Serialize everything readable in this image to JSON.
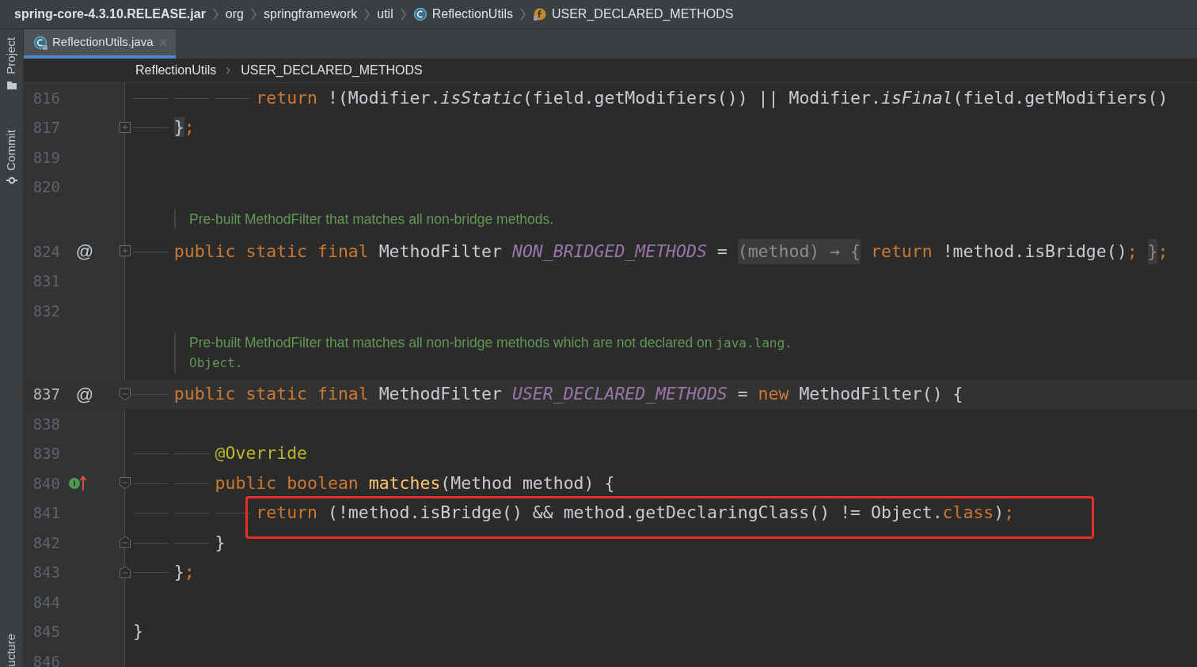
{
  "breadcrumbs": [
    {
      "text": "spring-core-4.3.10.RELEASE.jar",
      "kind": "jar"
    },
    {
      "text": "org",
      "kind": "package"
    },
    {
      "text": "springframework",
      "kind": "package"
    },
    {
      "text": "util",
      "kind": "package"
    },
    {
      "text": "ReflectionUtils",
      "kind": "class"
    },
    {
      "text": "USER_DECLARED_METHODS",
      "kind": "field"
    }
  ],
  "side_tabs": [
    {
      "label": "Project",
      "kind": "folder"
    },
    {
      "label": "Commit",
      "kind": "commit"
    },
    {
      "label": "ucture",
      "kind": "bottom"
    }
  ],
  "tabs": [
    {
      "label": "ReflectionUtils.java",
      "selected": true
    }
  ],
  "editor_breadcrumbs": [
    "ReflectionUtils",
    "USER_DECLARED_METHODS"
  ],
  "lines": [
    {
      "kind": "code",
      "number": "816",
      "current": false,
      "marked": false,
      "tokens": [
        {
          "text": "            return",
          "kind": "kw"
        },
        {
          "text": " !(Modifier.",
          "kind": "plain"
        },
        {
          "text": "isStatic",
          "kind": "italic"
        },
        {
          "text": "(field.getModifiers()) || Modifier.",
          "kind": "plain"
        },
        {
          "text": "isFinal",
          "kind": "italic"
        },
        {
          "text": "(field.getModifiers()",
          "kind": "plain"
        }
      ]
    },
    {
      "kind": "code",
      "number": "817",
      "current": false,
      "marked": false,
      "fold": {
        "kind": "plus"
      },
      "tokens": [
        {
          "text": "    }",
          "kind": "match"
        },
        {
          "text": ";",
          "kind": "kw"
        }
      ]
    },
    {
      "kind": "code",
      "number": "819",
      "current": false,
      "marked": false
    },
    {
      "kind": "code",
      "number": "820",
      "current": false,
      "marked": false
    },
    {
      "kind": "doc",
      "lines": [
        [
          {
            "text": "Pre-built MethodFilter that matches all non-bridge methods.",
            "kind": "prose"
          }
        ]
      ]
    },
    {
      "kind": "code",
      "number": "824",
      "current": false,
      "marked": false,
      "gutter": {
        "kind": "at",
        "text": "@"
      },
      "fold": {
        "kind": "plus"
      },
      "tokens": [
        {
          "text": "    public static final",
          "kind": "kw"
        },
        {
          "text": " MethodFilter ",
          "kind": "plain"
        },
        {
          "text": "NON_BRIDGED_METHODS",
          "kind": "const"
        },
        {
          "text": " = ",
          "kind": "plain"
        },
        {
          "text": "(method) → {",
          "kind": "folded"
        },
        {
          "text": " return",
          "kind": "kw"
        },
        {
          "text": " !method.isBridge()",
          "kind": "plain"
        },
        {
          "text": "; ",
          "kind": "kw"
        },
        {
          "text": "}",
          "kind": "folded"
        },
        {
          "text": ";",
          "kind": "kw"
        }
      ]
    },
    {
      "kind": "code",
      "number": "831",
      "current": false,
      "marked": false
    },
    {
      "kind": "code",
      "number": "832",
      "current": false,
      "marked": false
    },
    {
      "kind": "doc",
      "lines": [
        [
          {
            "text": "Pre-built MethodFilter that matches all non-bridge methods which are not declared on ",
            "kind": "prose"
          },
          {
            "text": "java.lang.",
            "kind": "code"
          }
        ],
        [
          {
            "text": "Object.",
            "kind": "code"
          }
        ]
      ]
    },
    {
      "kind": "code",
      "number": "837",
      "current": true,
      "marked": false,
      "gutter": {
        "kind": "at",
        "text": "@"
      },
      "fold": {
        "kind": "open"
      },
      "tokens": [
        {
          "text": "    public static final",
          "kind": "kw"
        },
        {
          "text": " MethodFilter ",
          "kind": "plain"
        },
        {
          "text": "USER_DECLARED_METHODS",
          "kind": "const"
        },
        {
          "text": " = ",
          "kind": "plain"
        },
        {
          "text": "new",
          "kind": "kw"
        },
        {
          "text": " MethodFilter() {",
          "kind": "plain"
        }
      ]
    },
    {
      "kind": "code",
      "number": "838",
      "current": false,
      "marked": false
    },
    {
      "kind": "code",
      "number": "839",
      "current": false,
      "marked": false,
      "tokens": [
        {
          "text": "        @Override",
          "kind": "annotation"
        }
      ]
    },
    {
      "kind": "code",
      "number": "840",
      "current": false,
      "marked": false,
      "gutter": {
        "kind": "implements"
      },
      "fold": {
        "kind": "open"
      },
      "tokens": [
        {
          "text": "        public boolean ",
          "kind": "kw"
        },
        {
          "text": "matches",
          "kind": "method"
        },
        {
          "text": "(Method method) {",
          "kind": "plain"
        }
      ]
    },
    {
      "kind": "code",
      "number": "841",
      "current": false,
      "marked": true,
      "tokens": [
        {
          "text": "            return",
          "kind": "kw"
        },
        {
          "text": " (!method.isBridge() && method.getDeclaringClass() != Object.",
          "kind": "plain"
        },
        {
          "text": "class",
          "kind": "kw"
        },
        {
          "text": ")",
          "kind": "plain"
        },
        {
          "text": ";",
          "kind": "kw"
        }
      ]
    },
    {
      "kind": "code",
      "number": "842",
      "current": false,
      "marked": false,
      "fold": {
        "kind": "close"
      },
      "tokens": [
        {
          "text": "        }",
          "kind": "plain"
        }
      ]
    },
    {
      "kind": "code",
      "number": "843",
      "current": false,
      "marked": false,
      "fold": {
        "kind": "close"
      },
      "tokens": [
        {
          "text": "    }",
          "kind": "plain"
        },
        {
          "text": ";",
          "kind": "kw"
        }
      ]
    },
    {
      "kind": "code",
      "number": "844",
      "current": false,
      "marked": false
    },
    {
      "kind": "code",
      "number": "845",
      "current": false,
      "marked": false,
      "tokens": [
        {
          "text": "}",
          "kind": "plain"
        }
      ]
    },
    {
      "kind": "code",
      "number": "846",
      "current": false,
      "marked": false
    }
  ]
}
